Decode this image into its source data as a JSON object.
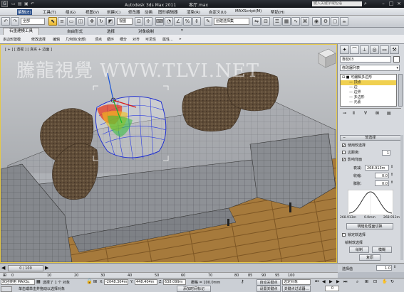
{
  "window": {
    "app_title": "Autodesk 3ds Max  2011",
    "file_name": "客厅.max",
    "search_placeholder": "键入关键字或短语",
    "logo": "G"
  },
  "menu": {
    "items": [
      "编辑(E)",
      "工具(T)",
      "组(G)",
      "视图(V)",
      "创建(C)",
      "修改器",
      "动画",
      "图形编辑器",
      "渲染(R)",
      "自定义(U)",
      "MAXScript(M)",
      "帮助(H)"
    ]
  },
  "toolbar": {
    "selection_filter": "全部",
    "named_selection": "创建选择集",
    "view_coord": "视图"
  },
  "ribbon": {
    "tabs": [
      "石墨建模工具",
      "自由形式",
      "选择",
      "对象绘制"
    ],
    "row": [
      "多边形建模",
      "修改选择",
      "编辑",
      "几何体(全部)",
      "顶点",
      "循环",
      "细分",
      "对齐",
      "可见性",
      "属性..."
    ]
  },
  "viewport": {
    "label": "[ + ] [ 透视 ] [ 真实 + 边面 ]",
    "watermark": "騰龍視覺 WWW.TLVI.NET"
  },
  "command_panel": {
    "object_name": "靠枕03",
    "modifier_list": "修改器列表",
    "stack": [
      {
        "label": "可编辑多边形",
        "selected": false
      },
      {
        "label": "顶点",
        "selected": true
      },
      {
        "label": "边",
        "selected": false
      },
      {
        "label": "边界",
        "selected": false
      },
      {
        "label": "多边形",
        "selected": false
      },
      {
        "label": "元素",
        "selected": false
      }
    ],
    "rollout_title": "软选择",
    "use_soft_selection": "使用软选择",
    "edge_distance": "边距离:",
    "edge_distance_value": "1",
    "affect_backfacing": "影响背面",
    "falloff_label": "衰减:",
    "falloff_value": "268.913m",
    "pinch_label": "收缩:",
    "pinch_value": "0.0",
    "bubble_label": "膨胀:",
    "bubble_value": "0.0",
    "curve_left": "268.913m",
    "curve_mid": "0.0mm",
    "curve_right": "268.913m",
    "shaded_face_toggle": "明暗处理面切换",
    "lock_soft_selection": "锁定软选择",
    "paint_soft_selection": "绘制软选择",
    "paint_button": "绘制",
    "blur_button": "模糊",
    "revert_button": "复原",
    "selection_value_label": "选择值",
    "selection_value": "1.0"
  },
  "timeline": {
    "frame": "0 / 100",
    "ticks": [
      "0",
      "10",
      "20",
      "30",
      "40",
      "50",
      "60",
      "70",
      "80",
      "85",
      "90",
      "95",
      "100"
    ]
  },
  "status": {
    "welcome": "欢迎使用 MAXSc",
    "selection_info": "选择了 1 个 对象",
    "prompt": "单击或单击并拖动以选择对象",
    "x_label": "X:",
    "x_value": "-2048.304m",
    "y_label": "Y:",
    "y_value": "448.404m",
    "z_label": "Z:",
    "z_value": "638.099m",
    "grid": "栅格 = 100.0mm",
    "add_time_tag": "添加时间标记",
    "auto_key": "自动关键点",
    "set_key": "设置关键点",
    "selected_object": "选定对象",
    "key_filters": "关键点过滤器...",
    "frame_value": "0"
  }
}
